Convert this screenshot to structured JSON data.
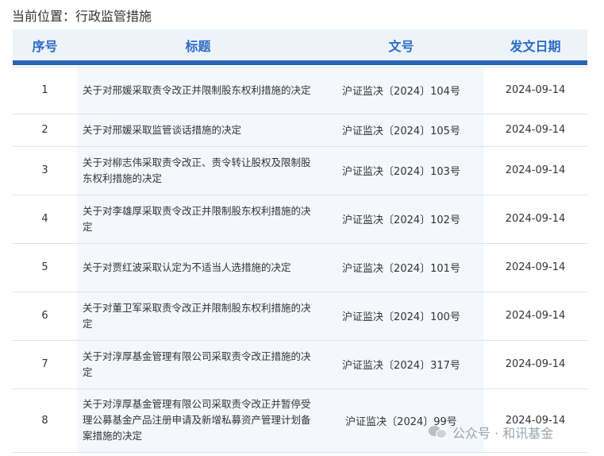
{
  "breadcrumb": "当前位置：行政监管措施",
  "table": {
    "headers": {
      "index": "序号",
      "title": "标题",
      "doc_no": "文号",
      "date": "发文日期"
    },
    "rows": [
      {
        "index": "1",
        "title": "关于对邢媛采取责令改正并限制股东权利措施的决定",
        "doc_no": "沪证监决〔2024〕104号",
        "date": "2024-09-14"
      },
      {
        "index": "2",
        "title": "关于对邢媛采取监管谈话措施的决定",
        "doc_no": "沪证监决〔2024〕105号",
        "date": "2024-09-14"
      },
      {
        "index": "3",
        "title": "关于对柳志伟采取责令改正、责令转让股权及限制股东权利措施的决定",
        "doc_no": "沪证监决〔2024〕103号",
        "date": "2024-09-14"
      },
      {
        "index": "4",
        "title": "关于对李雄厚采取责令改正并限制股东权利措施的决定",
        "doc_no": "沪证监决〔2024〕102号",
        "date": "2024-09-14"
      },
      {
        "index": "5",
        "title": "关于对贾红波采取认定为不适当人选措施的决定",
        "doc_no": "沪证监决〔2024〕101号",
        "date": "2024-09-14"
      },
      {
        "index": "6",
        "title": "关于对董卫军采取责令改正并限制股东权利措施的决定",
        "doc_no": "沪证监决〔2024〕100号",
        "date": "2024-09-14"
      },
      {
        "index": "7",
        "title": "关于对淳厚基金管理有限公司采取责令改正措施的决定",
        "doc_no": "沪证监决〔2024〕317号",
        "date": "2024-09-14"
      },
      {
        "index": "8",
        "title": "关于对淳厚基金管理有限公司采取责令改正并暂停受理公募基金产品注册申请及新增私募资产管理计划备案措施的决定",
        "doc_no": "沪证监决〔2024〕99号",
        "date": "2024-09-14"
      }
    ]
  },
  "watermark": {
    "icon": "wechat-icon",
    "text": "公众号 · 和讯基金"
  }
}
